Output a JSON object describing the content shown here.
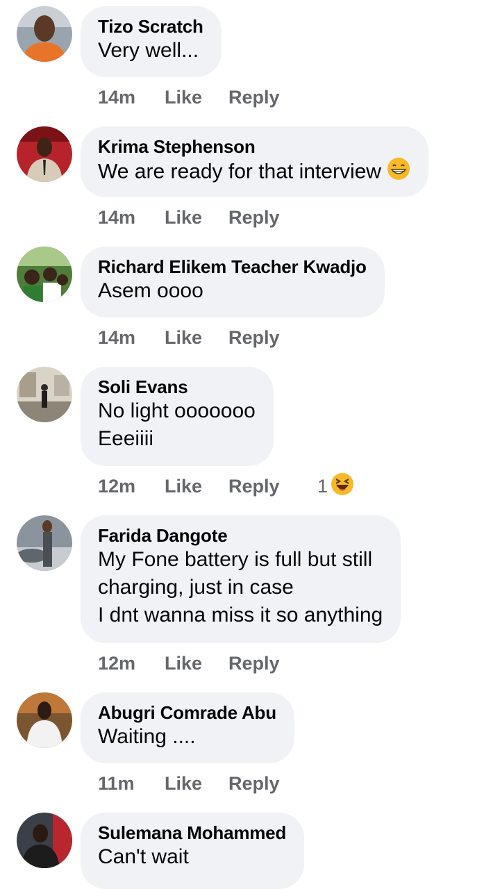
{
  "comments": [
    {
      "author": "Tizo Scratch",
      "lines": [
        "Very well..."
      ],
      "time": "14m",
      "like": "Like",
      "reply": "Reply",
      "avatar": "avatar-photo"
    },
    {
      "author": "Krima Stephenson",
      "lines": [
        "We are ready for that interview"
      ],
      "emoji": "grinning-face-icon",
      "time": "14m",
      "like": "Like",
      "reply": "Reply",
      "avatar": "avatar-photo"
    },
    {
      "author": "Richard Elikem Teacher Kwadjo",
      "lines": [
        "Asem oooo"
      ],
      "time": "14m",
      "like": "Like",
      "reply": "Reply",
      "avatar": "avatar-photo"
    },
    {
      "author": "Soli Evans",
      "lines": [
        "No light ooooooo",
        "Eeeiiii"
      ],
      "time": "12m",
      "like": "Like",
      "reply": "Reply",
      "reaction_count": "1",
      "reaction_icon": "laughing-face-icon",
      "avatar": "avatar-photo"
    },
    {
      "author": "Farida Dangote",
      "lines": [
        "My Fone battery is full but still",
        "charging, just in case",
        "I dnt wanna miss it so anything"
      ],
      "time": "12m",
      "like": "Like",
      "reply": "Reply",
      "avatar": "avatar-photo"
    },
    {
      "author": "Abugri Comrade Abu",
      "lines": [
        "Waiting ...."
      ],
      "time": "11m",
      "like": "Like",
      "reply": "Reply",
      "avatar": "avatar-photo"
    },
    {
      "author": "Sulemana Mohammed",
      "lines": [
        "Can't wait"
      ],
      "avatar": "avatar-photo"
    }
  ],
  "colors": {
    "bubble": "#f0f2f5",
    "meta": "#65676b",
    "text": "#050505",
    "emoji": "#f7b928"
  }
}
